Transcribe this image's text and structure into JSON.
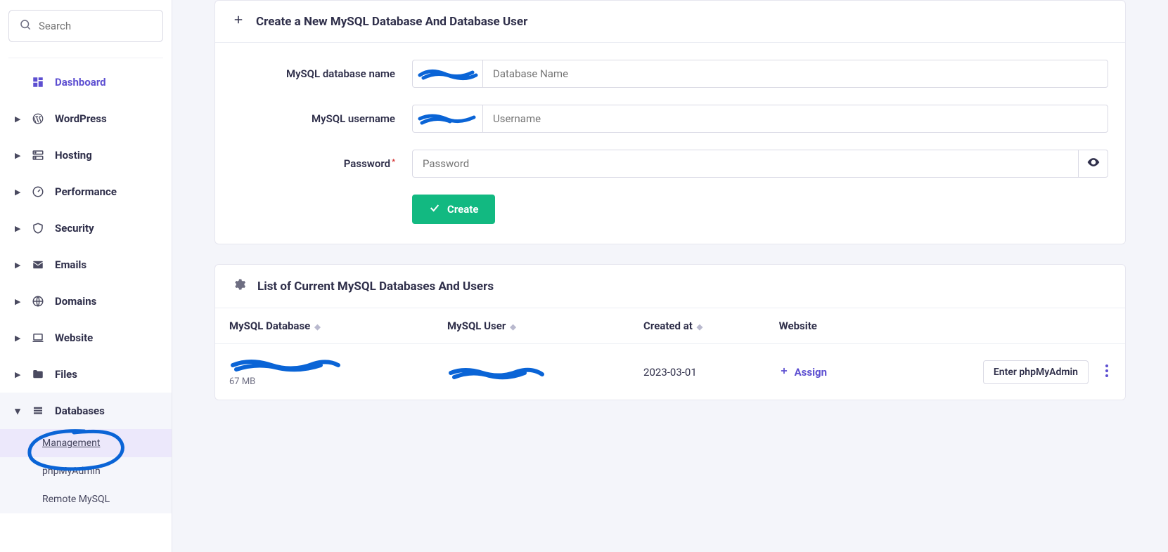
{
  "sidebar": {
    "search_placeholder": "Search",
    "items": [
      {
        "label": "Dashboard",
        "icon": "dashboard",
        "expandable": false,
        "active": true
      },
      {
        "label": "WordPress",
        "icon": "wordpress",
        "expandable": true
      },
      {
        "label": "Hosting",
        "icon": "servers",
        "expandable": true
      },
      {
        "label": "Performance",
        "icon": "gauge",
        "expandable": true
      },
      {
        "label": "Security",
        "icon": "shield",
        "expandable": true
      },
      {
        "label": "Emails",
        "icon": "mail",
        "expandable": true
      },
      {
        "label": "Domains",
        "icon": "globe",
        "expandable": true
      },
      {
        "label": "Website",
        "icon": "laptop",
        "expandable": true
      },
      {
        "label": "Files",
        "icon": "folder",
        "expandable": true
      },
      {
        "label": "Databases",
        "icon": "database",
        "expandable": true,
        "expanded": true,
        "children": [
          {
            "label": "Management",
            "active": true
          },
          {
            "label": "phpMyAdmin"
          },
          {
            "label": "Remote MySQL"
          }
        ]
      }
    ]
  },
  "create_card": {
    "title": "Create a New MySQL Database And Database User",
    "db_label": "MySQL database name",
    "db_placeholder": "Database Name",
    "user_label": "MySQL username",
    "user_placeholder": "Username",
    "pw_label": "Password",
    "pw_placeholder": "Password",
    "create_btn": "Create"
  },
  "list_card": {
    "title": "List of Current MySQL Databases And Users",
    "columns": {
      "db": "MySQL Database",
      "user": "MySQL User",
      "created": "Created at",
      "website": "Website"
    },
    "rows": [
      {
        "size": "67 MB",
        "created_at": "2023-03-01",
        "assign_label": "Assign",
        "phpmyadmin_btn": "Enter phpMyAdmin"
      }
    ]
  }
}
